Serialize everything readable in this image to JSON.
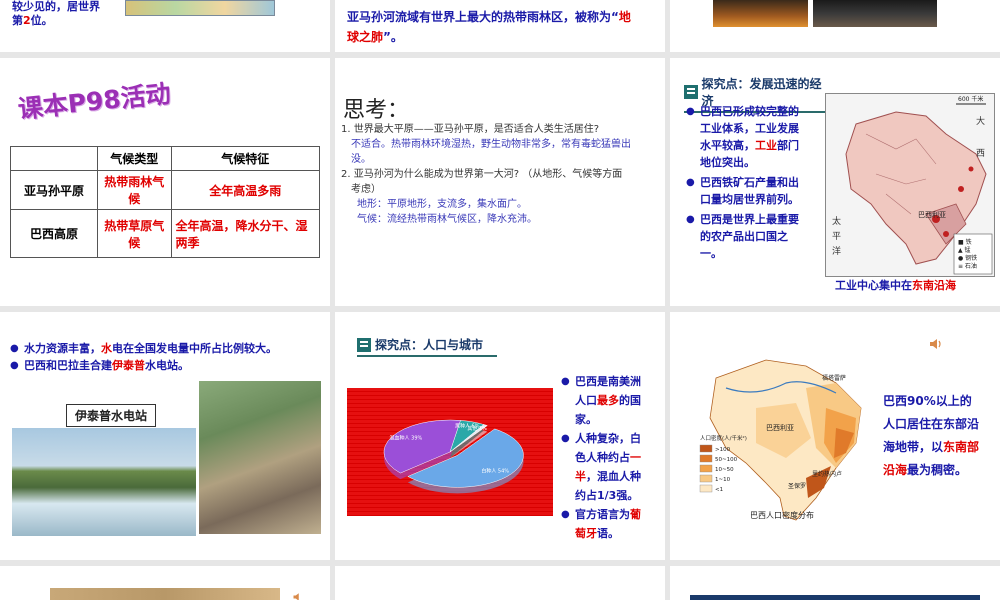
{
  "top_left": {
    "t1": "较少见的，居世界",
    "t2_pre": "第",
    "t2_num": "2",
    "t2_post": "位。"
  },
  "top_mid": {
    "t1": "亚马孙河流域有世界上最大的热带雨林区，被称为“",
    "t2": "地",
    "t3": "球之肺",
    "t4": "”。"
  },
  "s1": {
    "title": "课本P98活动",
    "table": {
      "header": [
        "",
        "气候类型",
        "气候特征"
      ],
      "rows": [
        [
          "亚马孙平原",
          "热带雨林气候",
          "全年高温多雨"
        ],
        [
          "巴西高原",
          "热带草原气候",
          "全年高温，降水分干、湿两季"
        ]
      ]
    }
  },
  "s2": {
    "title": "思考：",
    "q1": "1. 世界最大平原——亚马孙平原，是否适合人类生活居住?",
    "a1": "不适合。热带雨林环境湿热，野生动物非常多，常有毒蛇猛兽出没。",
    "q2": "2. 亚马孙河为什么能成为世界第一大河? （从地形、气候等方面考虑）",
    "a2a": "地形：平原地形，支流多，集水面广。",
    "a2b": "气候：流经热带雨林气候区，降水充沛。"
  },
  "s3": {
    "section": "探究点：发展迅速的经济",
    "b1a": "巴西已形成较完整的工业体系，工业发展水平较高，",
    "b1b": "工业",
    "b1c": "部门地位突出。",
    "b2": "巴西铁矿石产量和出口量均居世界前列。",
    "b3": "巴西是世界上最重要的农产品出口国之一。",
    "caption_pre": "工业中心集中在",
    "caption_red": "东南沿海",
    "map_scale": "600 千米",
    "map_labels": [
      "大",
      "西",
      "洋",
      "太",
      "平",
      "洋",
      "巴西利亚"
    ]
  },
  "s4": {
    "b1a": "水力资源丰富，",
    "b1b": "水",
    "b1c": "电在全国发电量中所占比例较大。",
    "b2a": "巴西和巴拉圭合建",
    "b2b": "伊泰普",
    "b2c": "水电站。",
    "label": "伊泰普水电站"
  },
  "s5": {
    "section": "探究点：人口与城市",
    "b1a": "巴西是南美洲人口",
    "b1b": "最多",
    "b1c": "的国家。",
    "b2a": "人种复杂，白色人种约占",
    "b2b": "一半",
    "b2c": "，混血人种约占1/3强。",
    "b3a": "官方语言为",
    "b3b": "葡萄牙",
    "b3c": "语。",
    "pie_labels": [
      "白种人",
      "混血种人",
      "黑种人",
      "其他"
    ],
    "pie_values": [
      54,
      39,
      6,
      1
    ]
  },
  "s6": {
    "t1": "巴西90%以上的人口居住在东部沿海地带，以",
    "t2": "东南部沿海",
    "t3": "最为稠密。",
    "map_title": "巴西人口密度分布",
    "legend_title": "人口密度(人/千米²)",
    "legend": [
      ">100",
      "50~100",
      "10~50",
      "1~10",
      "<1"
    ],
    "colors": [
      "#c0561a",
      "#e07a2a",
      "#f2a24a",
      "#f8c985",
      "#fde8c4"
    ]
  }
}
